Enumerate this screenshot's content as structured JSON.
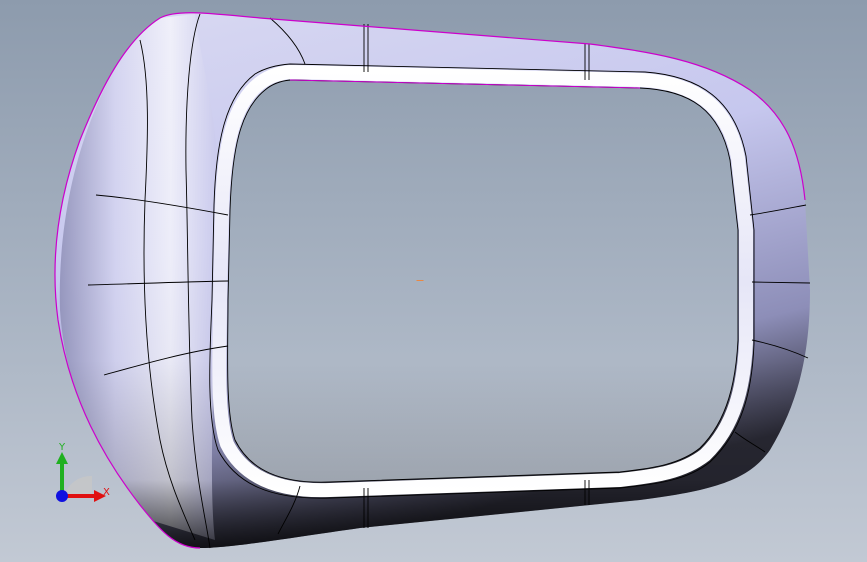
{
  "viewport": {
    "background_top": "#8d9bad",
    "background_bottom": "#c2c9d4"
  },
  "model": {
    "shading_light": "#f7f7fc",
    "shading_mid": "#b5b6e6",
    "shading_dark": "#1c1c24",
    "edge_color": "#000000",
    "silhouette_color": "#cc00cc"
  },
  "triad": {
    "x_label": "X",
    "y_label": "Y",
    "x_color": "#e01010",
    "y_color": "#20b020",
    "z_color": "#1010e0"
  },
  "origin_marker_color": "#ff7a1a"
}
